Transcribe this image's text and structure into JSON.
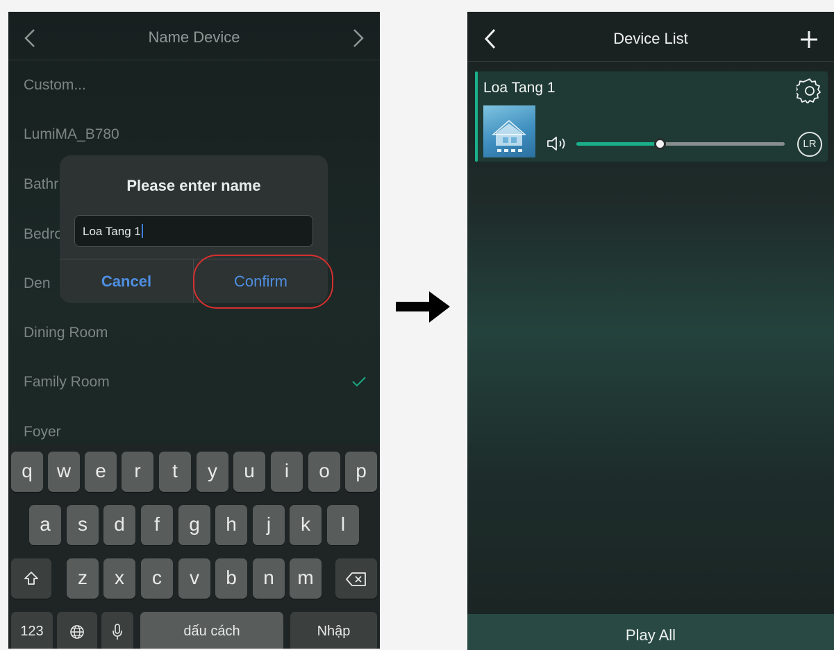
{
  "left_screen": {
    "nav": {
      "title": "Name Device"
    },
    "rooms": [
      "Custom...",
      "LumiMA_B780",
      "Bathr",
      "Bedro",
      "Den",
      "Dining Room",
      "Family Room",
      "Foyer"
    ],
    "dialog": {
      "title": "Please enter name",
      "input_value": "Loa Tang 1",
      "cancel_label": "Cancel",
      "confirm_label": "Confirm"
    },
    "keyboard": {
      "row1": [
        "q",
        "w",
        "e",
        "r",
        "t",
        "y",
        "u",
        "i",
        "o",
        "p"
      ],
      "row2": [
        "a",
        "s",
        "d",
        "f",
        "g",
        "h",
        "j",
        "k",
        "l"
      ],
      "row3": [
        "z",
        "x",
        "c",
        "v",
        "b",
        "n",
        "m"
      ],
      "numbers_label": "123",
      "space_label": "dấu cách",
      "return_label": "Nhập"
    }
  },
  "right_screen": {
    "nav": {
      "title": "Device List"
    },
    "device": {
      "name": "Loa Tang 1",
      "channel_badge": "LR",
      "volume_fraction": 0.4
    },
    "play_all_label": "Play All"
  },
  "colors": {
    "accent_green": "#19b08a",
    "ios_blue": "#4f8fe3",
    "highlight_red": "#d72f2f"
  }
}
